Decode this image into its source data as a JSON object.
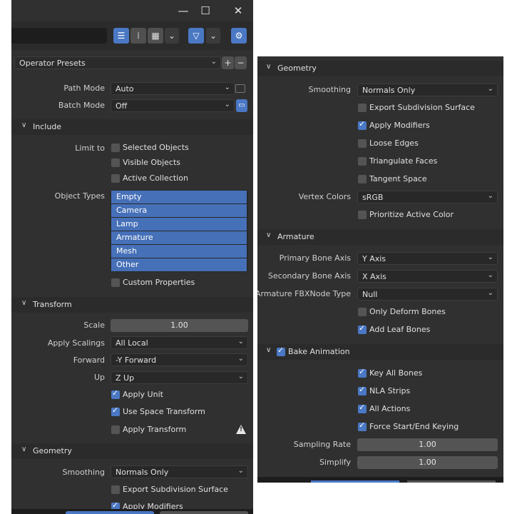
{
  "window": {
    "minimize": "—",
    "maximize": "☐",
    "close": "✕"
  },
  "left": {
    "presets": {
      "label": "Operator Presets",
      "add": "+",
      "remove": "−"
    },
    "path_mode": {
      "label": "Path Mode",
      "value": "Auto"
    },
    "batch_mode": {
      "label": "Batch Mode",
      "value": "Off"
    },
    "include": {
      "title": "Include",
      "limit_to_label": "Limit to",
      "selected_objects": "Selected Objects",
      "visible_objects": "Visible Objects",
      "active_collection": "Active Collection",
      "object_types_label": "Object Types",
      "object_types": [
        "Empty",
        "Camera",
        "Lamp",
        "Armature",
        "Mesh",
        "Other"
      ],
      "custom_properties": "Custom Properties"
    },
    "transform": {
      "title": "Transform",
      "scale_label": "Scale",
      "scale_value": "1.00",
      "apply_scalings_label": "Apply Scalings",
      "apply_scalings_value": "All Local",
      "forward_label": "Forward",
      "forward_value": "-Y Forward",
      "up_label": "Up",
      "up_value": "Z Up",
      "apply_unit": "Apply Unit",
      "use_space_transform": "Use Space Transform",
      "apply_transform": "Apply Transform"
    },
    "geometry": {
      "title": "Geometry",
      "smoothing_label": "Smoothing",
      "smoothing_value": "Normals Only",
      "export_subdiv": "Export Subdivision Surface",
      "apply_modifiers": "Apply Modifiers"
    }
  },
  "right": {
    "geometry": {
      "title": "Geometry",
      "smoothing_label": "Smoothing",
      "smoothing_value": "Normals Only",
      "export_subdiv": "Export Subdivision Surface",
      "apply_modifiers": "Apply Modifiers",
      "loose_edges": "Loose Edges",
      "triangulate_faces": "Triangulate Faces",
      "tangent_space": "Tangent Space",
      "vertex_colors_label": "Vertex Colors",
      "vertex_colors_value": "sRGB",
      "prioritize_active_color": "Prioritize Active Color"
    },
    "armature": {
      "title": "Armature",
      "primary_label": "Primary Bone Axis",
      "primary_value": "Y Axis",
      "secondary_label": "Secondary Bone Axis",
      "secondary_value": "X Axis",
      "node_type_label": "Armature FBXNode Type",
      "node_type_value": "Null",
      "only_deform": "Only Deform Bones",
      "add_leaf": "Add Leaf Bones"
    },
    "bake": {
      "title": "Bake Animation",
      "key_all_bones": "Key All Bones",
      "nla_strips": "NLA Strips",
      "all_actions": "All Actions",
      "force_keying": "Force Start/End Keying",
      "sampling_label": "Sampling Rate",
      "sampling_value": "1.00",
      "simplify_label": "Simplify",
      "simplify_value": "1.00"
    }
  }
}
